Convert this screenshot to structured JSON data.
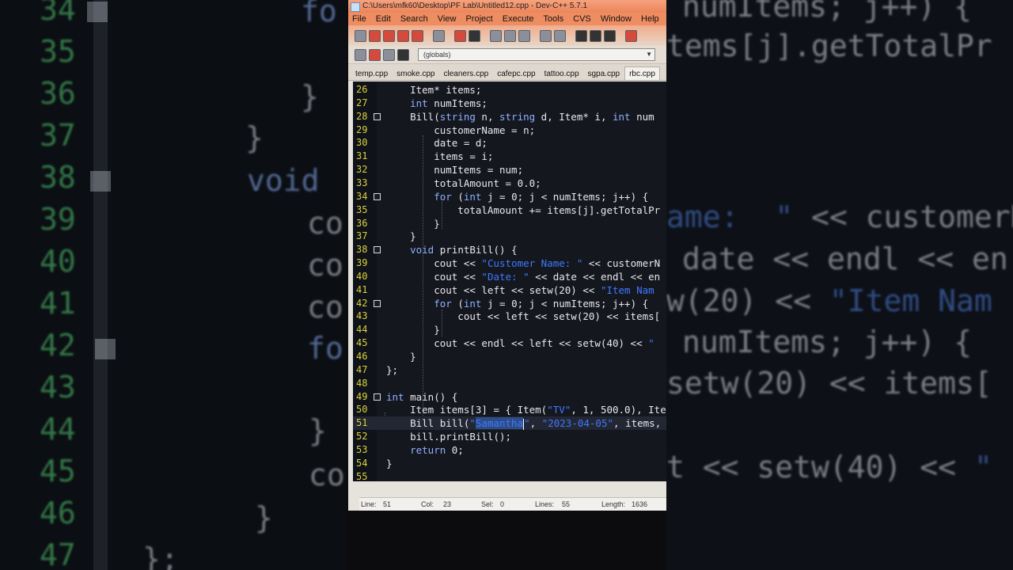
{
  "window": {
    "title": "C:\\Users\\mfk60\\Desktop\\PF Lab\\Untitled12.cpp - Dev-C++ 5.7.1"
  },
  "menu": [
    "File",
    "Edit",
    "Search",
    "View",
    "Project",
    "Execute",
    "Tools",
    "CVS",
    "Window",
    "Help"
  ],
  "toolbar": {
    "scope_value": "(globals)"
  },
  "tabs": [
    "temp.cpp",
    "smoke.cpp",
    "cleaners.cpp",
    "cafepc.cpp",
    "tattoo.cpp",
    "sgpa.cpp",
    "rbc.cpp"
  ],
  "editor": {
    "lines": [
      {
        "n": "26",
        "t": "    Item* items;"
      },
      {
        "n": "27",
        "t": "    int numItems;"
      },
      {
        "n": "28",
        "t": "    Bill(string n, string d, Item* i, int num"
      },
      {
        "n": "29",
        "t": "        customerName = n;"
      },
      {
        "n": "30",
        "t": "        date = d;"
      },
      {
        "n": "31",
        "t": "        items = i;"
      },
      {
        "n": "32",
        "t": "        numItems = num;"
      },
      {
        "n": "33",
        "t": "        totalAmount = 0.0;"
      },
      {
        "n": "34",
        "t": "        for (int j = 0; j < numItems; j++) {"
      },
      {
        "n": "35",
        "t": "            totalAmount += items[j].getTotalPr"
      },
      {
        "n": "36",
        "t": "        }"
      },
      {
        "n": "37",
        "t": "    }"
      },
      {
        "n": "38",
        "t": "    void printBill() {"
      },
      {
        "n": "39",
        "t": "        cout << \"Customer Name: \" << customerN"
      },
      {
        "n": "40",
        "t": "        cout << \"Date: \" << date << endl << en"
      },
      {
        "n": "41",
        "t": "        cout << left << setw(20) << \"Item Nam"
      },
      {
        "n": "42",
        "t": "        for (int j = 0; j < numItems; j++) {"
      },
      {
        "n": "43",
        "t": "            cout << left << setw(20) << items["
      },
      {
        "n": "44",
        "t": "        }"
      },
      {
        "n": "45",
        "t": "        cout << endl << left << setw(40) << \""
      },
      {
        "n": "46",
        "t": "    }"
      },
      {
        "n": "47",
        "t": "};"
      },
      {
        "n": "48",
        "t": ""
      },
      {
        "n": "49",
        "t": "int main() {"
      },
      {
        "n": "50",
        "t": "    Item items[3] = { Item(\"TV\", 1, 500.0), Ite"
      },
      {
        "n": "51",
        "t": "    Bill bill(\"Samantha\", \"2023-04-05\", items,"
      },
      {
        "n": "52",
        "t": "    bill.printBill();"
      },
      {
        "n": "53",
        "t": "    return 0;"
      },
      {
        "n": "54",
        "t": "}"
      },
      {
        "n": "55",
        "t": ""
      }
    ]
  },
  "status": {
    "line_label": "Line:",
    "line_value": "51",
    "col_label": "Col:",
    "col_value": "23",
    "sel_label": "Sel:",
    "sel_value": "0",
    "lines_label": "Lines:",
    "lines_value": "55",
    "length_label": "Length:",
    "length_value": "1636"
  },
  "background_left": [
    "34",
    "35",
    "36",
    "37",
    "38",
    "39",
    "40",
    "41",
    "42",
    "43",
    "44",
    "45",
    "46",
    "47"
  ],
  "background_right": [
    "numItems; j++) {",
    "tems[j].getTotalPr",
    "ame:  \" << customerN",
    "date << endl << en",
    "w(20) << \"Item Nam",
    "numItems; j++) {",
    "setw(20) << items[",
    "t << setw(40) << \""
  ]
}
